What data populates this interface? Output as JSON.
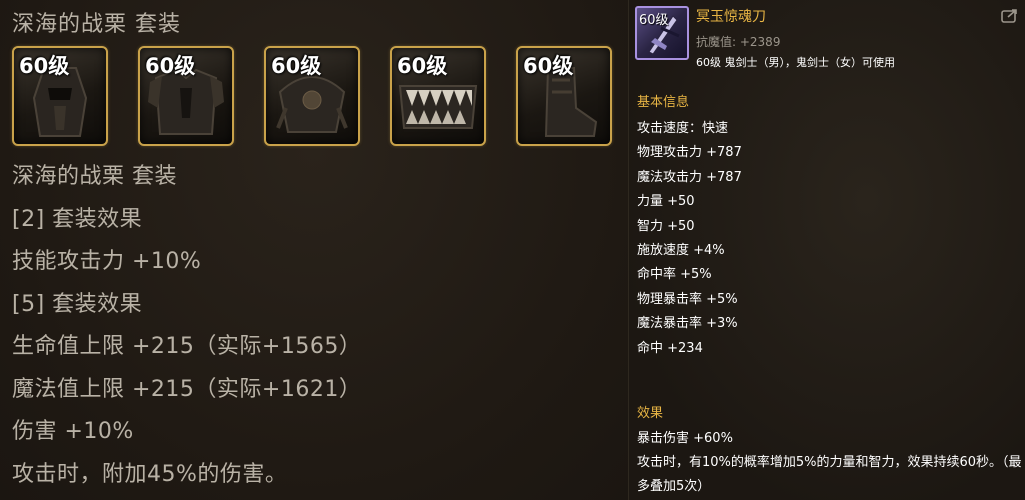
{
  "set": {
    "title": "深海的战栗 套装",
    "slots": [
      {
        "level": "60级",
        "art": "helmet"
      },
      {
        "level": "60级",
        "art": "armor"
      },
      {
        "level": "60级",
        "art": "shoulder"
      },
      {
        "level": "60级",
        "art": "jaws"
      },
      {
        "level": "60级",
        "art": "boots"
      }
    ],
    "lines": [
      "深海的战栗 套装",
      "[2] 套装效果",
      "技能攻击力 +10%",
      "[5] 套装效果",
      "生命值上限 +215（实际+1565）",
      "魔法值上限 +215（实际+1621）",
      "伤害 +10%",
      "攻击时，附加45%的伤害。"
    ]
  },
  "tooltip": {
    "icon_level": "60级",
    "name": "冥玉惊魂刀",
    "name_color": "#e8b544",
    "magic_defense": "抗魔值: +2389",
    "usable_by": "60级 鬼剑士（男），鬼剑士（女）可使用",
    "basic_title": "基本信息",
    "stats": [
      "攻击速度：快速",
      "物理攻击力 +787",
      "魔法攻击力 +787",
      "力量 +50",
      "智力 +50",
      "施放速度 +4%",
      "命中率 +5%",
      "物理暴击率 +5%",
      "魔法暴击率 +3%",
      "命中 +234"
    ],
    "effect_title": "效果",
    "effects": [
      "暴击伤害 +60%",
      "攻击时，有10%的概率增加5%的力量和智力，效果持续60秒。（最多叠加5次）"
    ]
  },
  "icons": {
    "share": "share-icon",
    "item": "sword-icon"
  }
}
